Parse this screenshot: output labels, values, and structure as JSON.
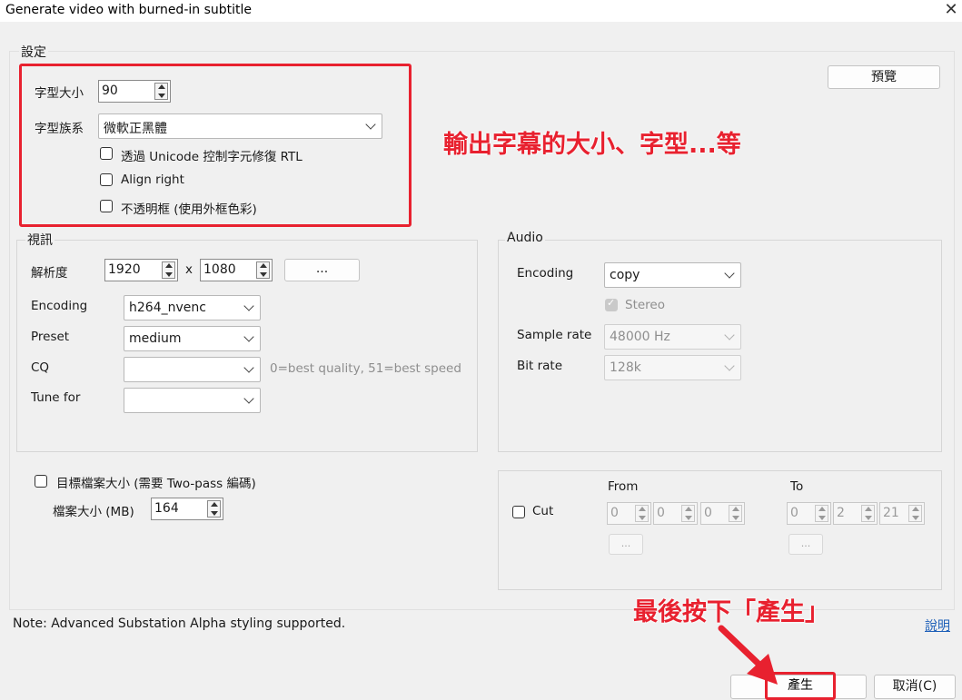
{
  "window": {
    "title": "Generate video with burned-in subtitle"
  },
  "settings": {
    "group_title": "設定",
    "font_size_label": "字型大小",
    "font_size_value": "90",
    "font_family_label": "字型族系",
    "font_family_value": "微軟正黑體",
    "rtl_fix_label": "透過 Unicode 控制字元修復 RTL",
    "align_right_label": "Align right",
    "opaque_box_label": "不透明框 (使用外框色彩)",
    "preview_button": "預覽"
  },
  "video": {
    "group_title": "視訊",
    "resolution_label": "解析度",
    "width": "1920",
    "x_label": "x",
    "height": "1080",
    "resolution_button": "...",
    "encoding_label": "Encoding",
    "encoding_value": "h264_nvenc",
    "preset_label": "Preset",
    "preset_value": "medium",
    "cq_label": "CQ",
    "cq_value": "",
    "cq_hint": "0=best quality, 51=best speed",
    "tune_label": "Tune for",
    "tune_value": ""
  },
  "audio": {
    "group_title": "Audio",
    "encoding_label": "Encoding",
    "encoding_value": "copy",
    "stereo_label": "Stereo",
    "stereo_checked": true,
    "sample_rate_label": "Sample rate",
    "sample_rate_value": "48000 Hz",
    "bit_rate_label": "Bit rate",
    "bit_rate_value": "128k"
  },
  "target_size": {
    "checkbox_label": "目標檔案大小 (需要 Two-pass 編碼)",
    "size_label": "檔案大小 (MB)",
    "size_value": "164"
  },
  "cut": {
    "checkbox_label": "Cut",
    "from_label": "From",
    "to_label": "To",
    "from_values": [
      "0",
      "0",
      "0"
    ],
    "to_values": [
      "0",
      "2",
      "21"
    ],
    "from_button": "...",
    "to_button": "..."
  },
  "footer": {
    "note": "Note: Advanced Substation Alpha styling supported.",
    "help_link": "說明",
    "generate_button": "產生",
    "cancel_button": "取消(C)"
  },
  "annotations": {
    "output_note": "輸出字幕的大小、字型...等",
    "final_note": "最後按下「產生」",
    "color": "#e8212f"
  }
}
